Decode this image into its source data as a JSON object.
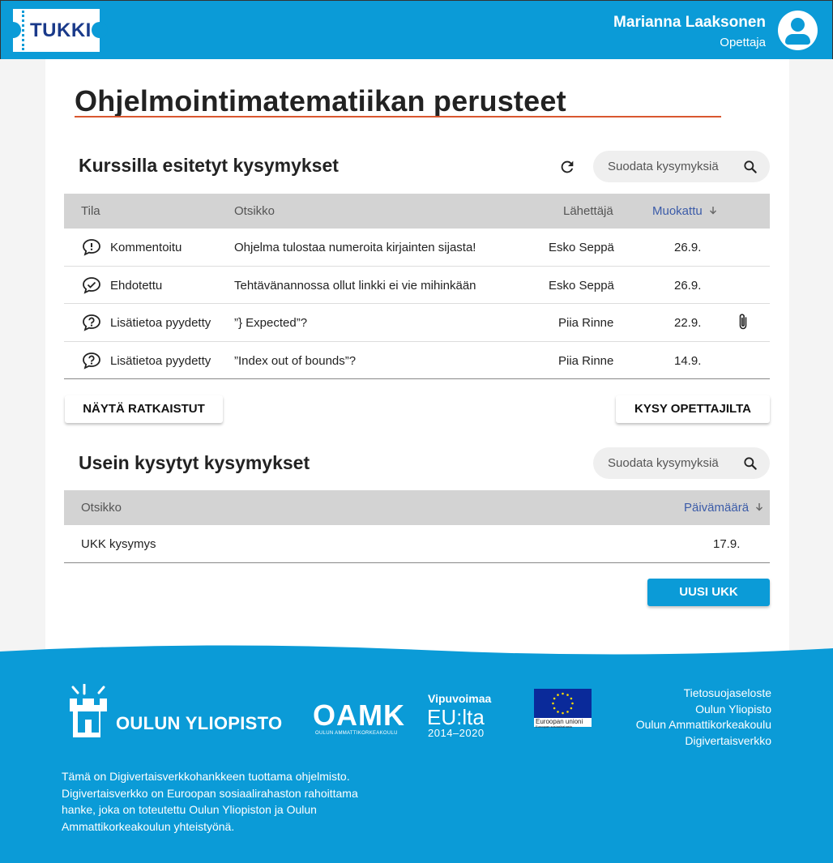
{
  "header": {
    "logo_text": "TUKKI",
    "user_name": "Marianna Laaksonen",
    "user_role": "Opettaja"
  },
  "course_title": "Ohjelmointimatematiikan perusteet",
  "course_questions": {
    "title": "Kurssilla esitetyt kysymykset",
    "search_placeholder": "Suodata kysymyksiä",
    "columns": {
      "status": "Tila",
      "subject": "Otsikko",
      "sender": "Lähettäjä",
      "modified": "Muokattu"
    },
    "rows": [
      {
        "status": "Kommentoitu",
        "subject": "Ohjelma tulostaa numeroita kirjainten sijasta!",
        "sender": "Esko Seppä",
        "date": "26.9."
      },
      {
        "status": "Ehdotettu",
        "subject": "Tehtävänannossa ollut linkki ei vie mihinkään",
        "sender": "Esko Seppä",
        "date": "26.9."
      },
      {
        "status": "Lisätietoa pyydetty",
        "subject": "”} Expected”?",
        "sender": "Piia Rinne",
        "date": "22.9."
      },
      {
        "status": "Lisätietoa pyydetty",
        "subject": "”Index out of bounds”?",
        "sender": "Piia Rinne",
        "date": "14.9."
      }
    ],
    "show_solved_button": "NÄYTÄ RATKAISTUT",
    "ask_teachers_button": "KYSY OPETTAJILTA"
  },
  "faq": {
    "title": "Usein kysytyt kysymykset",
    "search_placeholder": "Suodata kysymyksiä",
    "columns": {
      "subject": "Otsikko",
      "date": "Päivämäärä"
    },
    "rows": [
      {
        "subject": "UKK kysymys",
        "date": "17.9."
      }
    ],
    "new_faq_button": "UUSI UKK"
  },
  "footer": {
    "oulu_logo_text": "OULUN YLIOPISTO",
    "oamk_logo_text": "OAMK",
    "oamk_logo_sub": "OULUN AMMATTIKORKEAKOULU",
    "vipuvoimaa": [
      "Vipuvoimaa",
      "EU:lta",
      "2014–2020"
    ],
    "eu_text": [
      "Euroopan unioni",
      "Euroopan sosiaalirahasto"
    ],
    "links": [
      "Tietosuojaseloste",
      "Oulun Yliopisto",
      "Oulun Ammattikorkeakoulu",
      "Digivertaisverkko"
    ],
    "note": "Tämä on Digivertaisverkkohankkeen tuottama ohjelmisto. Digivertaisverkko on Euroopan sosiaalirahaston rahoittama hanke, joka on toteutettu Oulun Yliopiston ja Oulun Ammattikorkeakoulun yhteistyönä."
  },
  "colors": {
    "brand": "#0b9bd7",
    "title_underline": "#d9572f",
    "sort_header": "#3b5ba8",
    "eu_blue": "#0a2a9a"
  },
  "icons": {
    "status": [
      "comment-exclamation-icon",
      "comment-check-icon",
      "comment-question-icon",
      "comment-question-icon"
    ],
    "attachment_row": 2
  }
}
